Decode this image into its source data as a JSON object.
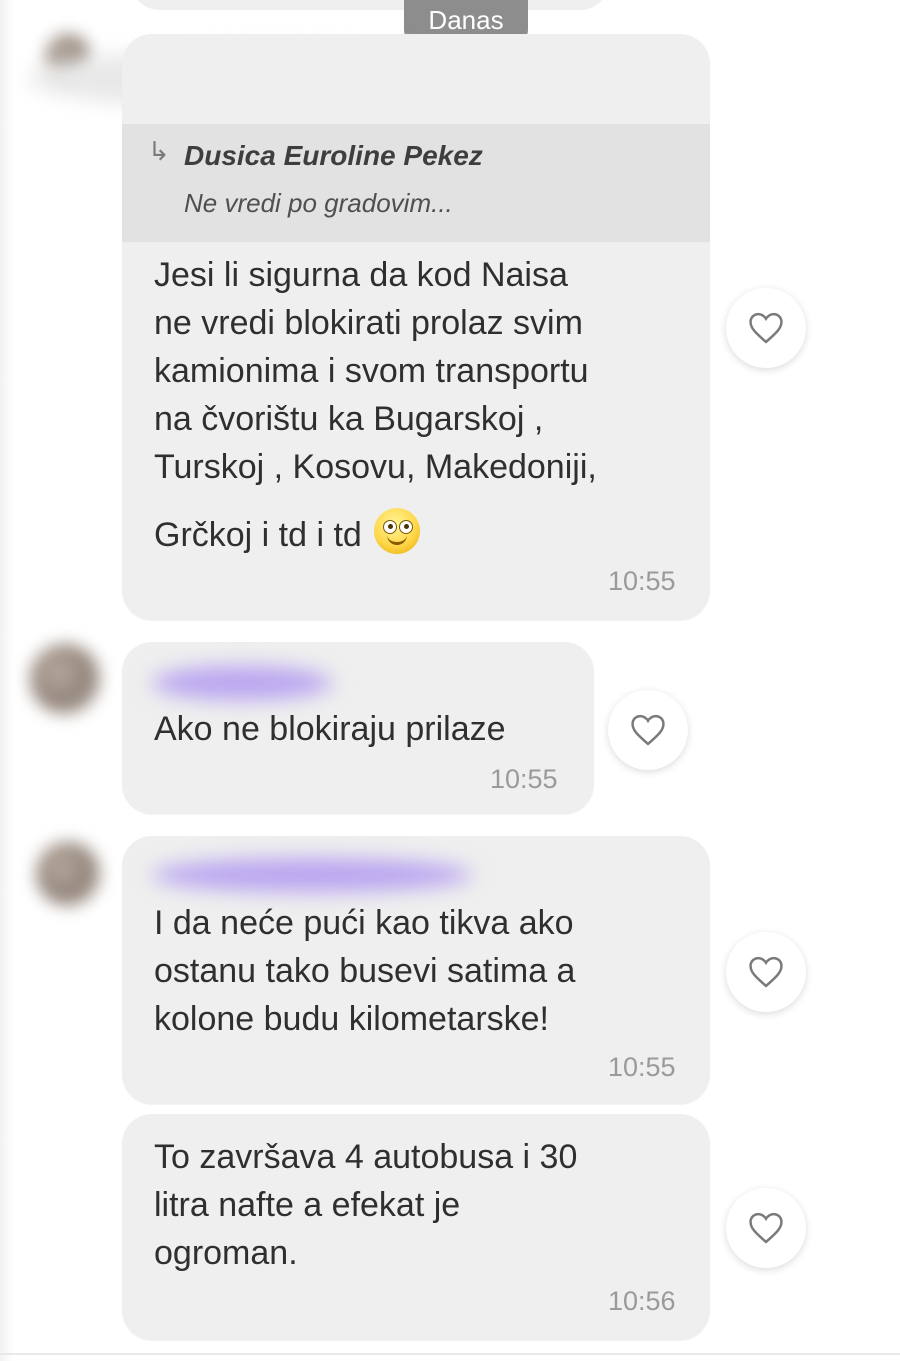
{
  "date_label": "Danas",
  "colors": {
    "bubble": "#efefef",
    "quote_background": "#e2e2e2",
    "date_chip": "#8d8d8d",
    "blurred_name_purple": "#b9a5f0"
  },
  "messages": [
    {
      "reply_quote": {
        "author": "Dusica Euroline Pekez",
        "text": "Ne vredi po gradovim..."
      },
      "lines": [
        "Jesi li sigurna da kod Naisa",
        "ne vredi blokirati prolaz svim",
        "kamionima i svom transportu",
        "na čvorištu ka Bugarskoj ,",
        "Turskoj , Kosovu, Makedoniji,",
        "Grčkoj i td i td"
      ],
      "emoji": "smiley-emoji",
      "time": "10:55"
    },
    {
      "lines": [
        "Ako ne blokiraju prilaze"
      ],
      "time": "10:55"
    },
    {
      "lines": [
        "I da neće pući kao tikva ako",
        "ostanu tako busevi satima a",
        "kolone budu kilometarske!"
      ],
      "time": "10:55"
    },
    {
      "lines": [
        "To završava 4 autobusa i 30",
        "litra nafte a efekat je",
        "ogroman."
      ],
      "time": "10:56"
    }
  ],
  "icons": {
    "like": "heart-outline-icon",
    "reply": "reply-arrow-icon"
  }
}
